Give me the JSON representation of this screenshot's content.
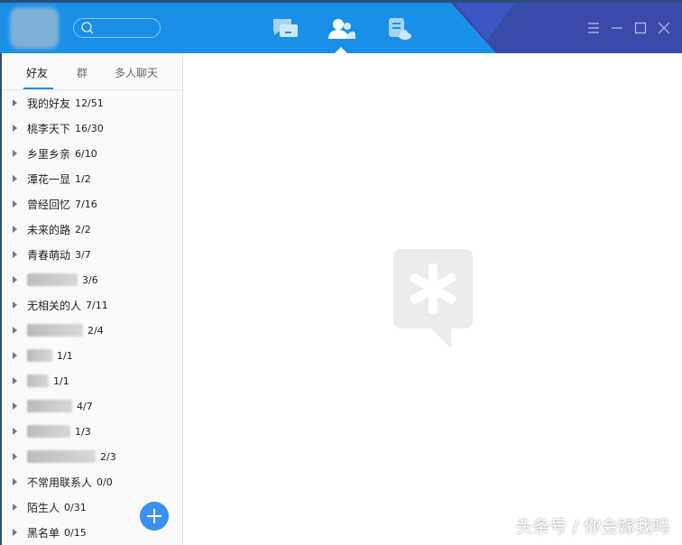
{
  "header": {
    "search_placeholder": ""
  },
  "tabs": [
    "好友",
    "群",
    "多人聊天"
  ],
  "groups": [
    {
      "name": "我的好友",
      "count": "12/51"
    },
    {
      "name": "桃李天下",
      "count": "16/30"
    },
    {
      "name": "乡里乡亲",
      "count": "6/10"
    },
    {
      "name": "潭花一显",
      "count": "1/2"
    },
    {
      "name": "曾经回忆",
      "count": "7/16"
    },
    {
      "name": "未来的路",
      "count": "2/2"
    },
    {
      "name": "青春萌动",
      "count": "3/7"
    },
    {
      "name": "",
      "count": "3/6"
    },
    {
      "name": "无相关的人",
      "count": "7/11"
    },
    {
      "name": "",
      "count": "2/4"
    },
    {
      "name": "",
      "count": "1/1"
    },
    {
      "name": "",
      "count": "1/1"
    },
    {
      "name": "",
      "count": "4/7"
    },
    {
      "name": "",
      "count": "1/3"
    },
    {
      "name": "",
      "count": "2/3"
    },
    {
      "name": "不常用联系人",
      "count": "0/0"
    },
    {
      "name": "陌生人",
      "count": "0/31"
    },
    {
      "name": "黑名单",
      "count": "0/15"
    }
  ],
  "watermark": "头条号 / 你会嫁我吗"
}
